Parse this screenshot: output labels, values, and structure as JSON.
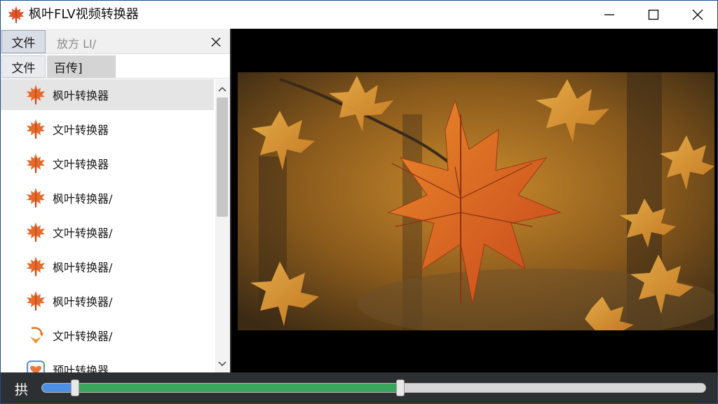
{
  "window": {
    "title": "枫叶FLV视频转换器",
    "controls": {
      "minimize": "minimize",
      "maximize": "maximize",
      "close": "close"
    }
  },
  "left_panel": {
    "tab_row_1": {
      "file_tab": "文件",
      "search_placeholder": "放方 LI/"
    },
    "tab_row_2": {
      "file_tab": "文件",
      "second_tab": "百传]"
    },
    "items": [
      {
        "label": "枫叶转换器",
        "icon": "maple-leaf-icon",
        "selected": true
      },
      {
        "label": "文叶转换器",
        "icon": "maple-leaf-icon"
      },
      {
        "label": "文叶转换器",
        "icon": "maple-leaf-icon"
      },
      {
        "label": "枫叶转换器/",
        "icon": "maple-leaf-icon"
      },
      {
        "label": "文叶转换器/",
        "icon": "maple-leaf-icon"
      },
      {
        "label": "枫叶转换器/",
        "icon": "maple-leaf-icon"
      },
      {
        "label": "枫叶转换器/",
        "icon": "maple-leaf-icon"
      },
      {
        "label": "文叶转换器/",
        "icon": "convert-arrows-icon"
      },
      {
        "label": "预叶转换器",
        "icon": "heart-app-icon"
      }
    ]
  },
  "player": {
    "control_label": "拱",
    "played_fraction": 0.05,
    "progress_fraction": 0.54
  },
  "colors": {
    "accent_blue": "#4c8fe6",
    "progress_green": "#3aa65b",
    "titlebar_border": "#1e4f8f"
  }
}
